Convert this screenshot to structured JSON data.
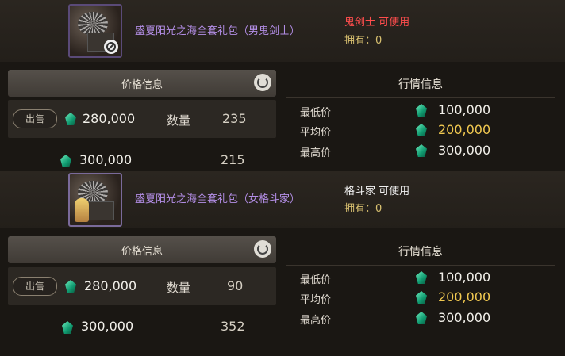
{
  "listings": [
    {
      "item_name": "盛夏阳光之海全套礼包（男鬼剑士）",
      "usable_class": "鬼剑士 可使用",
      "owned": "拥有：0",
      "usable_status": "restricted",
      "icon": "gift-package-icon",
      "price_panel": {
        "title": "价格信息",
        "sell_label": "出售",
        "qty_label": "数量",
        "rows": [
          {
            "price": "280,000",
            "qty": "235"
          },
          {
            "price": "300,000",
            "qty": "215"
          }
        ]
      },
      "market_panel": {
        "title": "行情信息",
        "min_label": "最低价",
        "min_value": "100,000",
        "avg_label": "平均价",
        "avg_value": "200,000",
        "max_label": "最高价",
        "max_value": "300,000"
      }
    },
    {
      "item_name": "盛夏阳光之海全套礼包（女格斗家）",
      "usable_class": "格斗家 可使用",
      "owned": "拥有：0",
      "usable_status": "usable",
      "icon": "gift-package-icon",
      "price_panel": {
        "title": "价格信息",
        "sell_label": "出售",
        "qty_label": "数量",
        "rows": [
          {
            "price": "280,000",
            "qty": "90"
          },
          {
            "price": "300,000",
            "qty": "352"
          }
        ]
      },
      "market_panel": {
        "title": "行情信息",
        "min_label": "最低价",
        "min_value": "100,000",
        "avg_label": "平均价",
        "avg_value": "200,000",
        "max_label": "最高价",
        "max_value": "300,000"
      }
    }
  ],
  "colors": {
    "item_name": "#b38ee6",
    "restricted": "#ff4d4d",
    "owned": "#d8c070",
    "avg_price": "#f0c850",
    "gem": "#30c890"
  }
}
